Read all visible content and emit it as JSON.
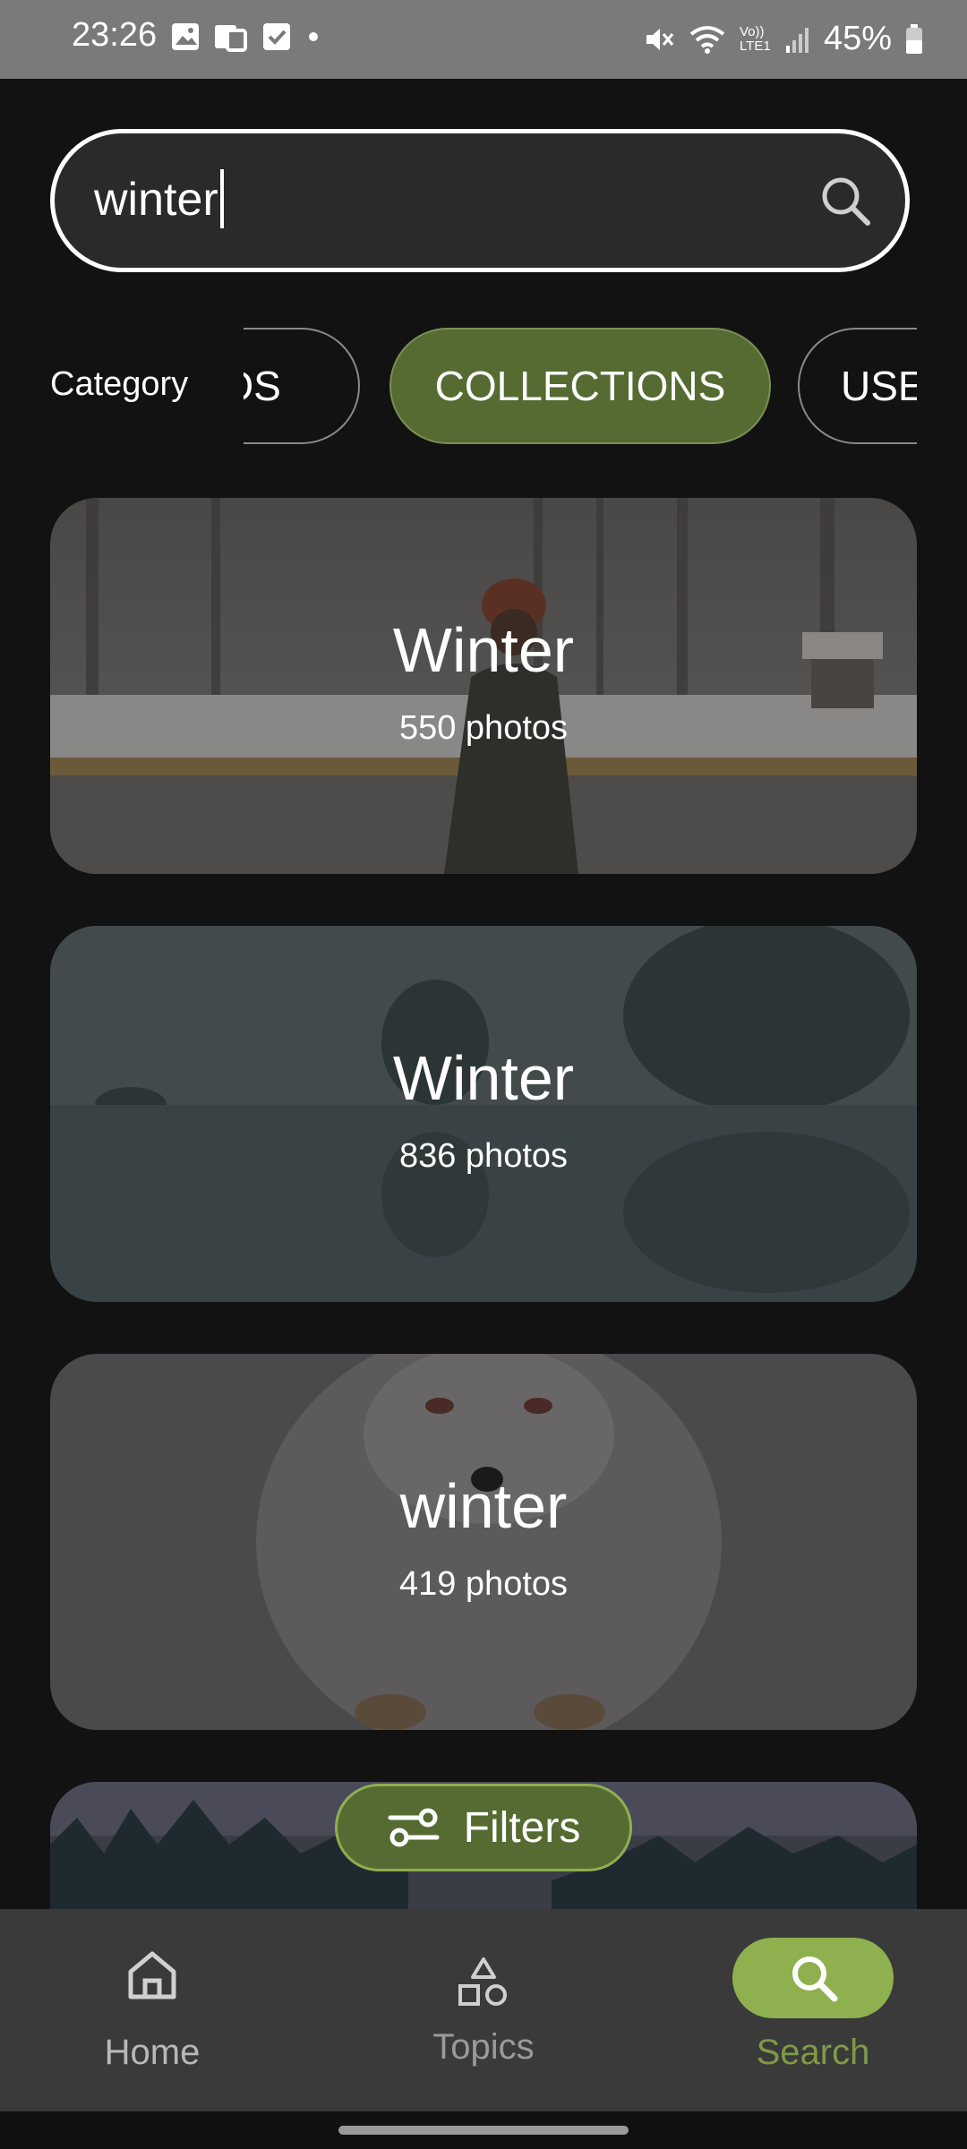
{
  "status_bar": {
    "time": "23:26",
    "battery": "45%",
    "icons_left": [
      "gallery-icon",
      "device-icon",
      "checkbox-icon",
      "dot-icon"
    ],
    "icons_right": [
      "mute-icon",
      "wifi-icon",
      "volte-icon",
      "signal-icon",
      "battery-icon"
    ],
    "volte_label": "Vo)) LTE1"
  },
  "search": {
    "value": "winter"
  },
  "category": {
    "label": "Category",
    "chips": [
      "TOS",
      "COLLECTIONS",
      "USE"
    ],
    "selected": "COLLECTIONS"
  },
  "results": [
    {
      "title": "Winter",
      "count": "550 photos"
    },
    {
      "title": "Winter",
      "count": "836 photos"
    },
    {
      "title": "winter",
      "count": "419 photos"
    }
  ],
  "filters_button": {
    "label": "Filters"
  },
  "nav": {
    "home": "Home",
    "topics": "Topics",
    "search": "Search",
    "active": "Search"
  },
  "colors": {
    "accent": "#556b32",
    "accent_light": "#8fb04e",
    "background": "#121212",
    "nav_background": "#3a3a3a"
  }
}
